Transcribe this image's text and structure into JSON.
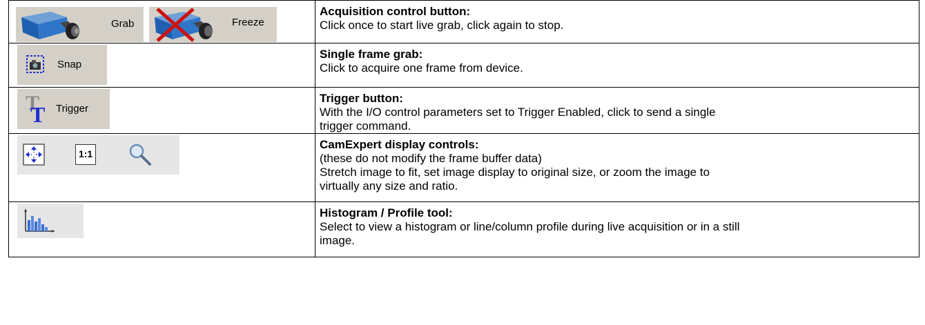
{
  "rows": [
    {
      "buttons": [
        {
          "label": "Grab",
          "icon": "camera-icon"
        },
        {
          "label": "Freeze",
          "icon": "camera-crossed-icon"
        }
      ],
      "title": "Acquisition control button:",
      "lines": [
        "Click once to start live grab, click again to stop."
      ]
    },
    {
      "buttons": [
        {
          "label": "Snap",
          "icon": "snapshot-camera-icon"
        }
      ],
      "title": "Single frame grab:",
      "lines": [
        "Click to acquire one frame from device."
      ]
    },
    {
      "buttons": [
        {
          "label": "Trigger",
          "icon": "trigger-t-icon"
        }
      ],
      "title": "Trigger button:",
      "lines": [
        "With the I/O control parameters set to Trigger Enabled, click to send a single",
        "trigger command."
      ]
    },
    {
      "buttons": [
        {
          "icon": "stretch-fit-icon"
        },
        {
          "label": "1:1",
          "icon": "original-size-icon"
        },
        {
          "icon": "zoom-magnifier-icon"
        }
      ],
      "title": "CamExpert display controls:",
      "lines": [
        "(these do not modify the frame buffer data)",
        "Stretch image to fit, set image display to original size, or zoom the image to",
        "virtually any size and ratio."
      ]
    },
    {
      "buttons": [
        {
          "icon": "histogram-icon"
        }
      ],
      "title": "Histogram / Profile tool:",
      "lines": [
        "Select to view a histogram or line/column profile during live acquisition or in a still",
        "image."
      ]
    }
  ]
}
